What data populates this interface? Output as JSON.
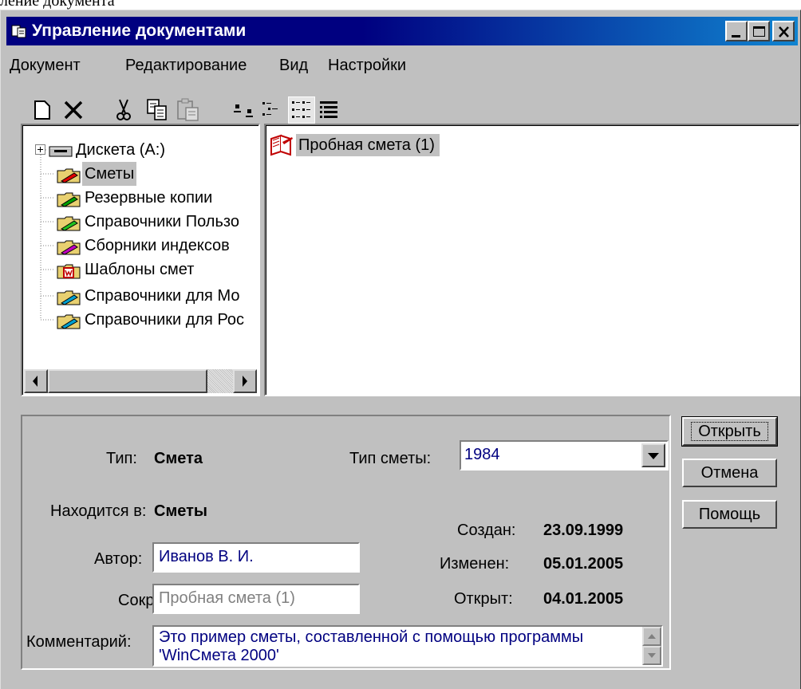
{
  "page_top_text": "ление документа",
  "window": {
    "title": "Управление документами"
  },
  "menu": [
    "Документ",
    "Редактирование",
    "Вид",
    "Настройки"
  ],
  "toolbar": [
    "new-doc-icon",
    "delete-icon",
    "cut-icon",
    "copy-icon",
    "paste-icon",
    "large-icons-icon",
    "small-icons-icon",
    "list-view-icon",
    "details-view-icon"
  ],
  "tree": {
    "items": [
      {
        "label": "Дискета (A:)",
        "icon": "floppy-drive-icon"
      },
      {
        "label": "Сметы",
        "icon": "folder-icon"
      },
      {
        "label": "Резервные копии",
        "icon": "folder-icon"
      },
      {
        "label": "Справочники Пользо",
        "icon": "folder-icon"
      },
      {
        "label": "Сборники индексов",
        "icon": "folder-icon"
      },
      {
        "label": "Шаблоны смет",
        "icon": "template-folder-icon"
      },
      {
        "label": "Справочники для Мо",
        "icon": "folder-icon"
      },
      {
        "label": "Справочники для Рос",
        "icon": "folder-icon"
      }
    ]
  },
  "files": [
    {
      "label": "Пробная смета (1)",
      "icon": "estimate-document-icon"
    }
  ],
  "properties": {
    "type_label": "Тип:",
    "type_value": "Смета",
    "estimate_type_label": "Тип сметы:",
    "estimate_type_value": "1984",
    "location_label": "Находится в:",
    "location_value": "Сметы",
    "author_label": "Автор:",
    "author_value": "Иванов В. И.",
    "short_label": "Сокр:",
    "short_value": "Пробная смета (1)",
    "created_label": "Создан:",
    "created_value": "23.09.1999",
    "modified_label": "Изменен:",
    "modified_value": "05.01.2005",
    "opened_label": "Открыт:",
    "opened_value": "04.01.2005",
    "comment_label": "Комментарий:",
    "comment_line1": "Это пример сметы, составленной с помощью программы",
    "comment_line2": "'WinСмета 2000'"
  },
  "buttons": {
    "open": "Открыть",
    "cancel": "Отмена",
    "help": "Помощь"
  }
}
